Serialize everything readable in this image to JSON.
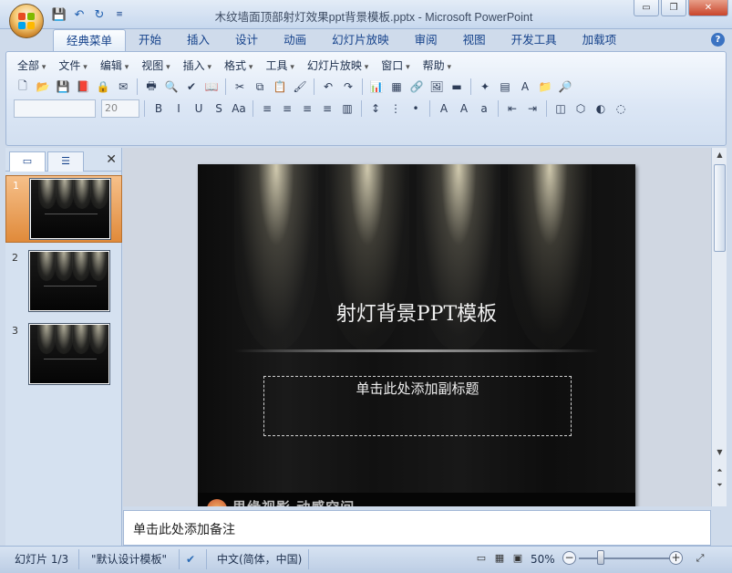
{
  "window": {
    "title": "木纹墙面顶部射灯效果ppt背景模板.pptx - Microsoft PowerPoint",
    "minimize": "▭",
    "restore": "❐",
    "close": "✕"
  },
  "qat": {
    "save_icon": "💾",
    "undo_icon": "↶",
    "redo_icon": "↻",
    "customize": "≡"
  },
  "ribbon_tabs": [
    "经典菜单",
    "开始",
    "插入",
    "设计",
    "动画",
    "幻灯片放映",
    "审阅",
    "视图",
    "开发工具",
    "加载项"
  ],
  "active_tab_index": 0,
  "help_label": "?",
  "menus": [
    "全部",
    "文件",
    "编辑",
    "视图",
    "插入",
    "格式",
    "工具",
    "幻灯片放映",
    "窗口",
    "帮助"
  ],
  "toolbar": {
    "row1": [
      {
        "name": "new-doc",
        "glyph": "🗋"
      },
      {
        "name": "open-folder",
        "glyph": "📂"
      },
      {
        "name": "save",
        "glyph": "💾"
      },
      {
        "name": "save-pdf",
        "glyph": "📕"
      },
      {
        "name": "permission",
        "glyph": "🔒"
      },
      {
        "name": "email",
        "glyph": "✉"
      },
      {
        "name": "print",
        "glyph": "🖶"
      },
      {
        "name": "print-preview",
        "glyph": "🔍"
      },
      {
        "name": "spelling",
        "glyph": "✔"
      },
      {
        "name": "research",
        "glyph": "📖"
      },
      {
        "name": "cut",
        "glyph": "✂"
      },
      {
        "name": "copy",
        "glyph": "⧉"
      },
      {
        "name": "paste",
        "glyph": "📋"
      },
      {
        "name": "format-painter",
        "glyph": "🖌"
      },
      {
        "name": "undo",
        "glyph": "↶"
      },
      {
        "name": "redo",
        "glyph": "↷"
      },
      {
        "name": "chart",
        "glyph": "📊"
      },
      {
        "name": "table",
        "glyph": "▦"
      },
      {
        "name": "hyperlink",
        "glyph": "🔗"
      },
      {
        "name": "picture",
        "glyph": "🖼"
      },
      {
        "name": "color",
        "glyph": "▬"
      },
      {
        "name": "new-slide",
        "glyph": "✦"
      },
      {
        "name": "layout",
        "glyph": "▤"
      },
      {
        "name": "textbox",
        "glyph": "A"
      },
      {
        "name": "open-panel",
        "glyph": "📁"
      },
      {
        "name": "find",
        "glyph": "🔎"
      }
    ],
    "font_name": "",
    "font_size": "20",
    "row2": [
      {
        "name": "bold",
        "glyph": "B"
      },
      {
        "name": "italic",
        "glyph": "I"
      },
      {
        "name": "underline",
        "glyph": "U"
      },
      {
        "name": "shadow",
        "glyph": "S"
      },
      {
        "name": "change-case",
        "glyph": "Aa"
      },
      {
        "name": "align-left",
        "glyph": "≡"
      },
      {
        "name": "align-center",
        "glyph": "≡"
      },
      {
        "name": "align-right",
        "glyph": "≡"
      },
      {
        "name": "justify",
        "glyph": "≡"
      },
      {
        "name": "columns",
        "glyph": "▥"
      },
      {
        "name": "line-spacing",
        "glyph": "↕"
      },
      {
        "name": "numbering",
        "glyph": "⋮"
      },
      {
        "name": "bullets",
        "glyph": "•"
      },
      {
        "name": "font-color",
        "glyph": "A"
      },
      {
        "name": "grow-font",
        "glyph": "A"
      },
      {
        "name": "shrink-font",
        "glyph": "a"
      },
      {
        "name": "decrease-indent",
        "glyph": "⇤"
      },
      {
        "name": "increase-indent",
        "glyph": "⇥"
      },
      {
        "name": "shapes",
        "glyph": "◫"
      },
      {
        "name": "arrange",
        "glyph": "⬡"
      },
      {
        "name": "shape-fill",
        "glyph": "◐"
      },
      {
        "name": "shape-outline",
        "glyph": "◌"
      }
    ]
  },
  "panel": {
    "close": "✕",
    "slides": [
      {
        "num": "1"
      },
      {
        "num": "2"
      },
      {
        "num": "3"
      }
    ],
    "selected_index": 0
  },
  "slide": {
    "title": "射灯背景PPT模板",
    "subtitle_placeholder": "单击此处添加副标题",
    "footer_text": "思缘视影 动感空间"
  },
  "notes_placeholder": "单击此处添加备注",
  "status": {
    "slide_count": "幻灯片 1/3",
    "theme": "\"默认设计模板\"",
    "language": "中文(简体，中国)",
    "zoom": "50%",
    "zoom_fraction": 0.5
  },
  "colors": {
    "ribbon_bg": "#cfdbeb",
    "selected_thumb": "#e08a3a",
    "slide_bg": "#111111"
  }
}
